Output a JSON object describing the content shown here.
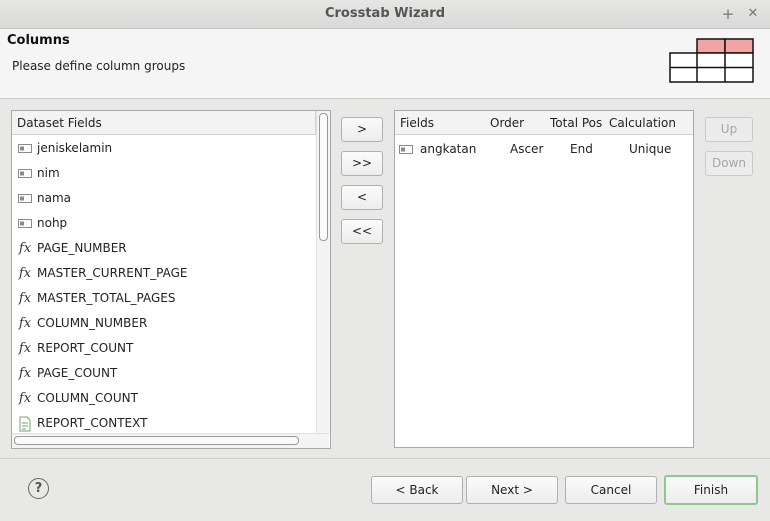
{
  "window": {
    "title": "Crosstab Wizard",
    "add_glyph": "+",
    "close_glyph": "✕"
  },
  "header": {
    "title": "Columns",
    "description": "Please define column groups",
    "icon": "crosstab-grid-icon"
  },
  "dataset": {
    "header": "Dataset Fields",
    "items": [
      {
        "label": "jeniskelamin",
        "icon": "field-icon"
      },
      {
        "label": "nim",
        "icon": "field-icon"
      },
      {
        "label": "nama",
        "icon": "field-icon"
      },
      {
        "label": "nohp",
        "icon": "field-icon"
      },
      {
        "label": "PAGE_NUMBER",
        "icon": "fx-icon"
      },
      {
        "label": "MASTER_CURRENT_PAGE",
        "icon": "fx-icon"
      },
      {
        "label": "MASTER_TOTAL_PAGES",
        "icon": "fx-icon"
      },
      {
        "label": "COLUMN_NUMBER",
        "icon": "fx-icon"
      },
      {
        "label": "REPORT_COUNT",
        "icon": "fx-icon"
      },
      {
        "label": "PAGE_COUNT",
        "icon": "fx-icon"
      },
      {
        "label": "COLUMN_COUNT",
        "icon": "fx-icon"
      },
      {
        "label": "REPORT_CONTEXT",
        "icon": "context-icon"
      }
    ]
  },
  "fx_glyph": "fx",
  "move_buttons": [
    ">",
    ">>",
    "<",
    "<<"
  ],
  "groups_table": {
    "columns": [
      "Fields",
      "Order",
      "Total Pos",
      "Calculation"
    ],
    "rows": [
      {
        "field": "angkatan",
        "order": "Ascer",
        "total_pos": "End",
        "calculation": "Unique"
      }
    ]
  },
  "side_buttons": {
    "up": "Up",
    "down": "Down"
  },
  "footer": {
    "help": "?",
    "back": "< Back",
    "next": "Next >",
    "cancel": "Cancel",
    "finish": "Finish"
  },
  "colors": {
    "grid_highlight": "#f4a3a3",
    "finish_border": "#8fc88f"
  }
}
